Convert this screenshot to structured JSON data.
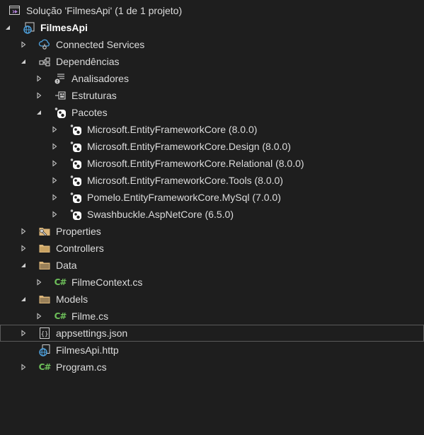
{
  "solution": {
    "label": "Solução 'FilmesApi' (1 de 1 projeto)"
  },
  "project": {
    "label": "FilmesApi"
  },
  "nodes": {
    "connected_services": "Connected Services",
    "dependencias": "Dependências",
    "analisadores": "Analisadores",
    "estruturas": "Estruturas",
    "pacotes": "Pacotes",
    "packages": [
      "Microsoft.EntityFrameworkCore (8.0.0)",
      "Microsoft.EntityFrameworkCore.Design (8.0.0)",
      "Microsoft.EntityFrameworkCore.Relational (8.0.0)",
      "Microsoft.EntityFrameworkCore.Tools (8.0.0)",
      "Pomelo.EntityFrameworkCore.MySql (7.0.0)",
      "Swashbuckle.AspNetCore (6.5.0)"
    ],
    "properties": "Properties",
    "controllers": "Controllers",
    "data": "Data",
    "filme_context": "FilmeContext.cs",
    "models": "Models",
    "filme": "Filme.cs",
    "appsettings": "appsettings.json",
    "http_file": "FilmesApi.http",
    "program": "Program.cs"
  },
  "icon_text": {
    "csharp": "C#",
    "json": "{}"
  },
  "colors": {
    "background": "#1e1e1e",
    "text": "#dcdcdc",
    "chevron": "#d0d0d0",
    "folder": "#dcb67a",
    "csharp_green": "#6ec05a",
    "globe_blue": "#4fa3e0",
    "selection_border": "#5a5a5a"
  }
}
